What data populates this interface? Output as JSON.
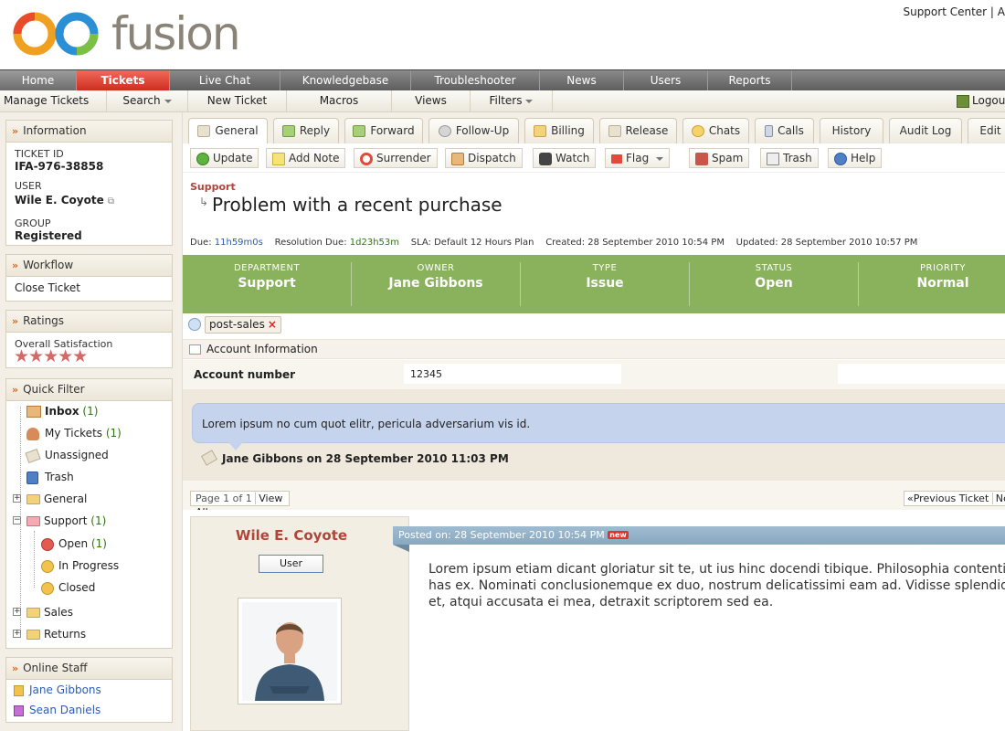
{
  "header": {
    "brand": "fusion",
    "top_links": "Support Center | A"
  },
  "main_nav": [
    {
      "label": "Home",
      "w": 84
    },
    {
      "label": "Tickets",
      "w": 102
    },
    {
      "label": "Live Chat",
      "w": 121
    },
    {
      "label": "Knowledgebase",
      "w": 143
    },
    {
      "label": "Troubleshooter",
      "w": 141
    },
    {
      "label": "News",
      "w": 92
    },
    {
      "label": "Users",
      "w": 92
    },
    {
      "label": "Reports",
      "w": 92
    }
  ],
  "sub_nav": {
    "manage": "Manage Tickets",
    "search": "Search",
    "new_ticket": "New Ticket",
    "macros": "Macros",
    "views": "Views",
    "filters": "Filters",
    "logout": "Logou"
  },
  "info": {
    "header": "Information",
    "ticket_id_label": "TICKET ID",
    "ticket_id": "IFA-976-38858",
    "user_label": "USER",
    "user": "Wile E. Coyote",
    "group_label": "GROUP",
    "group": "Registered"
  },
  "workflow": {
    "header": "Workflow",
    "item": "Close Ticket"
  },
  "ratings": {
    "header": "Ratings",
    "label": "Overall Satisfaction",
    "stars": "★★★★★",
    "value": 5
  },
  "quick_filter": {
    "header": "Quick Filter",
    "inbox": "Inbox",
    "inbox_count": "(1)",
    "my_tickets": "My Tickets",
    "my_tickets_count": "(1)",
    "unassigned": "Unassigned",
    "trash": "Trash",
    "general": "General",
    "support": "Support",
    "support_count": "(1)",
    "open": "Open",
    "open_count": "(1)",
    "in_progress": "In Progress",
    "closed": "Closed",
    "sales": "Sales",
    "returns": "Returns"
  },
  "online_staff": {
    "header": "Online Staff",
    "staff1": "Jane Gibbons",
    "staff2": "Sean Daniels"
  },
  "tabs": {
    "general": "General",
    "reply": "Reply",
    "forward": "Forward",
    "followup": "Follow-Up",
    "billing": "Billing",
    "release": "Release",
    "chats": "Chats",
    "calls": "Calls",
    "history": "History",
    "audit": "Audit Log",
    "edit": "Edit"
  },
  "toolbar": {
    "update": "Update",
    "add_note": "Add Note",
    "surrender": "Surrender",
    "dispatch": "Dispatch",
    "watch": "Watch",
    "flag": "Flag",
    "spam": "Spam",
    "trash": "Trash",
    "help": "Help"
  },
  "ticket": {
    "department_crumb": "Support",
    "subject": "Problem with a recent purchase",
    "due_label": "Due:",
    "due": "11h59m0s",
    "res_due_label": "Resolution Due:",
    "res_due": "1d23h53m",
    "sla": "SLA: Default 12 Hours Plan",
    "created": "Created: 28 September 2010 10:54 PM",
    "updated": "Updated: 28 September 2010 10:57 PM"
  },
  "properties": {
    "department_label": "DEPARTMENT",
    "department": "Support",
    "owner_label": "OWNER",
    "owner": "Jane Gibbons",
    "type_label": "TYPE",
    "type": "Issue",
    "status_label": "STATUS",
    "status": "Open",
    "priority_label": "PRIORITY",
    "priority": "Normal"
  },
  "tag": "post-sales",
  "account": {
    "section": "Account Information",
    "field_label": "Account number",
    "field_value": "12345"
  },
  "note": {
    "text": "Lorem ipsum no cum quot elitr, pericula adversarium vis id.",
    "author": "Jane Gibbons on 28 September 2010 11:03 PM"
  },
  "pager": {
    "page": "Page 1 of 1",
    "view_all": "View All",
    "prev": "«Previous Ticket",
    "next": "Nex"
  },
  "post": {
    "author": "Wile E. Coyote",
    "role": "User",
    "posted": "Posted on: 28 September 2010 10:54 PM",
    "new_badge": "new",
    "line1": "Lorem ipsum etiam dicant gloriatur sit te, ut ius hinc docendi tibique. Philosophia contenti",
    "line2": "has ex. Nominati conclusionemque ex duo, nostrum delicatissimi eam ad. Vidisse splendid",
    "line3": "et, atqui accusata ei mea, detraxit scriptorem sed ea."
  },
  "colors": {
    "accent_red": "#cf2d1f",
    "property_bar": "#8ab25c",
    "note_bubble": "#c5d4ec",
    "link_blue": "#2a5db0",
    "count_green": "#2b7a0b"
  }
}
